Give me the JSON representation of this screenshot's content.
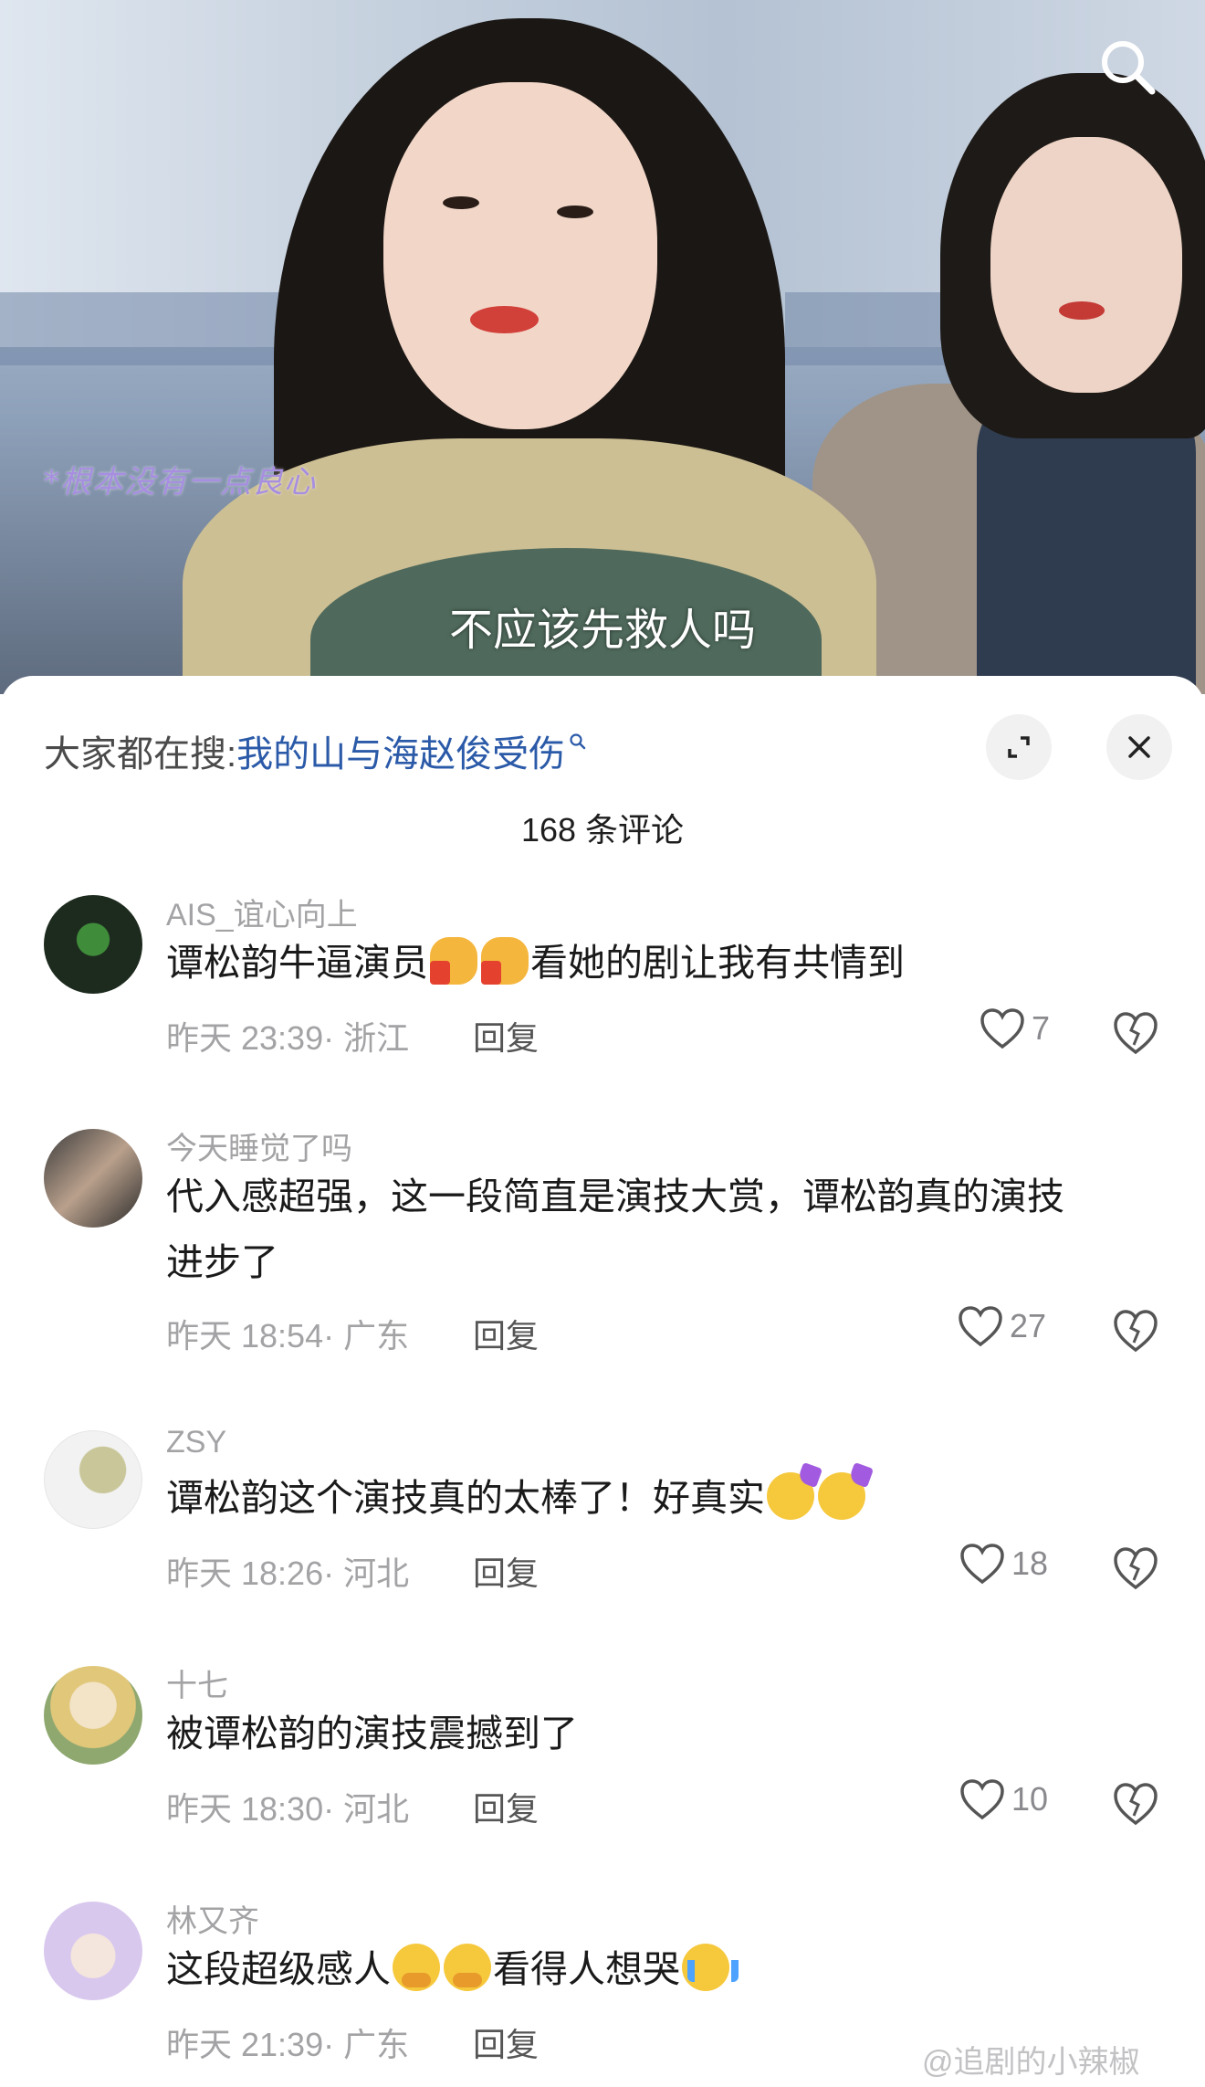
{
  "video": {
    "watermark": "*根本没有一点良心",
    "subtitle": "不应该先救人吗"
  },
  "sheet": {
    "search_prefix": "大家都在搜:",
    "search_link": "我的山与海赵俊受伤",
    "comment_count": "168 条评论",
    "reply_label": "回复"
  },
  "comments": [
    {
      "user": "AIS_谊心向上",
      "text_before": "谭松韵牛逼演员",
      "emojis": [
        "thumbs-up",
        "thumbs-up"
      ],
      "text_after": "看她的剧让我有共情到",
      "time": "昨天 23:39",
      "region": "浙江",
      "likes": "7"
    },
    {
      "user": "今天睡觉了吗",
      "text_line1": "代入感超强，这一段简直是演技大赏，谭松韵真的演技",
      "text_line2": "进步了",
      "time": "昨天 18:54",
      "region": "广东",
      "likes": "27"
    },
    {
      "user": "ZSY",
      "text_before": "谭松韵这个演技真的太棒了！好真实",
      "emojis": [
        "party-face",
        "party-face"
      ],
      "time": "昨天 18:26",
      "region": "河北",
      "likes": "18"
    },
    {
      "user": "十七",
      "text": "被谭松韵的演技震撼到了",
      "time": "昨天 18:30",
      "region": "河北",
      "likes": "10"
    },
    {
      "user": "林又齐",
      "text_before": "这段超级感人",
      "emojis_mid": [
        "holding-back-tears",
        "holding-back-tears"
      ],
      "text_after": "看得人想哭",
      "emojis_end": [
        "loudly-crying"
      ],
      "time": "昨天 21:39",
      "region": "广东"
    }
  ],
  "footer": {
    "watermark": "@追剧的小辣椒"
  },
  "icons": {
    "search": "search-icon",
    "expand": "expand-icon",
    "close": "close-icon",
    "like": "heart-icon",
    "dislike": "broken-heart-icon"
  },
  "colors": {
    "link": "#2b5aa8",
    "muted": "#a3a3a6",
    "text": "#1a1a1a"
  }
}
